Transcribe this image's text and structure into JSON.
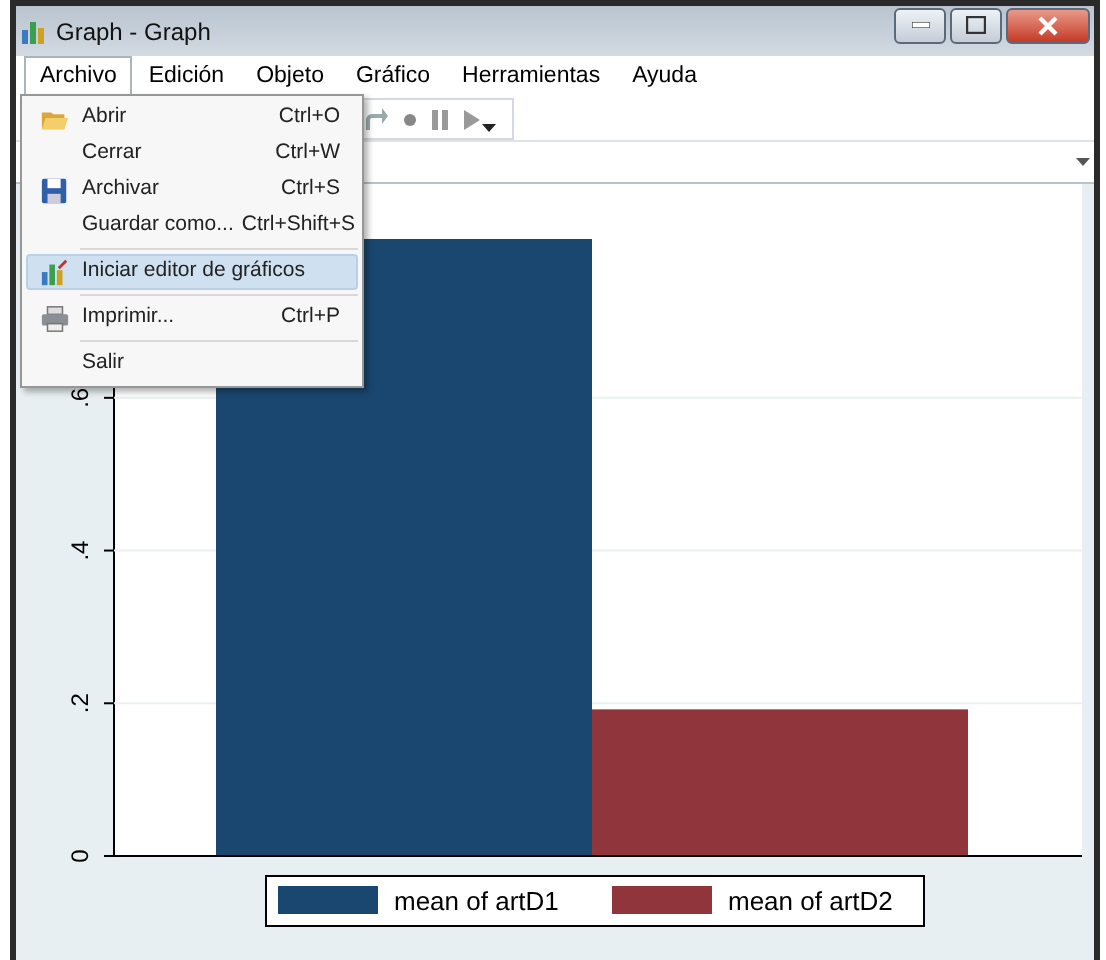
{
  "window": {
    "title": "Graph - Graph"
  },
  "menu_bar": [
    {
      "label": "Archivo",
      "selected": true
    },
    {
      "label": "Edición",
      "selected": false
    },
    {
      "label": "Objeto",
      "selected": false
    },
    {
      "label": "Gráfico",
      "selected": false
    },
    {
      "label": "Herramientas",
      "selected": false
    },
    {
      "label": "Ayuda",
      "selected": false
    }
  ],
  "file_menu": [
    {
      "kind": "item",
      "label": "Abrir",
      "shortcut": "Ctrl+O",
      "selected": false
    },
    {
      "kind": "item",
      "label": "Cerrar",
      "shortcut": "Ctrl+W",
      "selected": false
    },
    {
      "kind": "item",
      "label": "Archivar",
      "shortcut": "Ctrl+S",
      "selected": false
    },
    {
      "kind": "item",
      "label": "Guardar como...",
      "shortcut": "Ctrl+Shift+S",
      "selected": false
    },
    {
      "kind": "separator"
    },
    {
      "kind": "item",
      "label": "Iniciar editor de gráficos",
      "selected": true
    },
    {
      "kind": "separator"
    },
    {
      "kind": "item",
      "label": "Imprimir...",
      "shortcut": "Ctrl+P",
      "selected": false
    },
    {
      "kind": "separator"
    },
    {
      "kind": "item",
      "label": "Salir",
      "selected": false
    }
  ],
  "graph": {
    "chart_data": {
      "type": "bar",
      "grid": true,
      "legend": true,
      "series": [
        {
          "name": "mean of artD1",
          "color": "#1a476f",
          "values": [
            0.808
          ]
        },
        {
          "name": "mean of artD2",
          "color": "#90353b",
          "values": [
            0.192
          ]
        }
      ],
      "ylim": [
        0,
        0.88
      ],
      "yticks": [
        {
          "value": 0,
          "label": "0"
        },
        {
          "value": 0.2,
          "label": ".2"
        },
        {
          "value": 0.4,
          "label": ".4"
        },
        {
          "value": 0.6,
          "label": ".6"
        }
      ]
    }
  }
}
